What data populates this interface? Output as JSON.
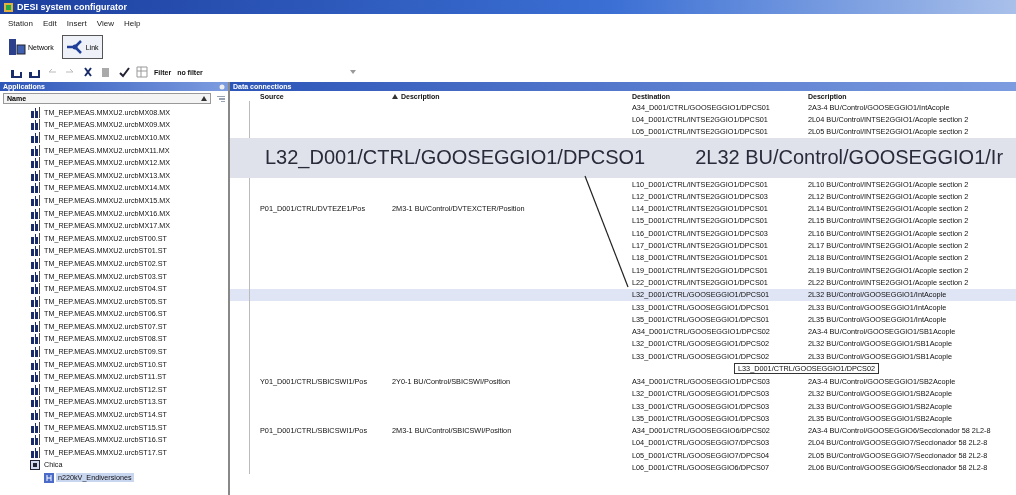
{
  "window": {
    "title": "DESI system configurator"
  },
  "menu": [
    "Station",
    "Edit",
    "Insert",
    "View",
    "Help"
  ],
  "modes": [
    {
      "label": "Network",
      "kind": "network",
      "selected": false
    },
    {
      "label": "Link",
      "kind": "link",
      "selected": true
    }
  ],
  "toolbar": {
    "filter_label": "Filter",
    "filter_value": "no filter"
  },
  "applications": {
    "title": "Applications",
    "column": "Name",
    "items": [
      {
        "label": "TM_REP.MEAS.MMXU2.urcbMX08.MX",
        "kind": "report"
      },
      {
        "label": "TM_REP.MEAS.MMXU2.urcbMX09.MX",
        "kind": "report"
      },
      {
        "label": "TM_REP.MEAS.MMXU2.urcbMX10.MX",
        "kind": "report"
      },
      {
        "label": "TM_REP.MEAS.MMXU2.urcbMX11.MX",
        "kind": "report"
      },
      {
        "label": "TM_REP.MEAS.MMXU2.urcbMX12.MX",
        "kind": "report"
      },
      {
        "label": "TM_REP.MEAS.MMXU2.urcbMX13.MX",
        "kind": "report"
      },
      {
        "label": "TM_REP.MEAS.MMXU2.urcbMX14.MX",
        "kind": "report"
      },
      {
        "label": "TM_REP.MEAS.MMXU2.urcbMX15.MX",
        "kind": "report"
      },
      {
        "label": "TM_REP.MEAS.MMXU2.urcbMX16.MX",
        "kind": "report"
      },
      {
        "label": "TM_REP.MEAS.MMXU2.urcbMX17.MX",
        "kind": "report"
      },
      {
        "label": "TM_REP.MEAS.MMXU2.urcbST00.ST",
        "kind": "report"
      },
      {
        "label": "TM_REP.MEAS.MMXU2.urcbST01.ST",
        "kind": "report"
      },
      {
        "label": "TM_REP.MEAS.MMXU2.urcbST02.ST",
        "kind": "report"
      },
      {
        "label": "TM_REP.MEAS.MMXU2.urcbST03.ST",
        "kind": "report"
      },
      {
        "label": "TM_REP.MEAS.MMXU2.urcbST04.ST",
        "kind": "report"
      },
      {
        "label": "TM_REP.MEAS.MMXU2.urcbST05.ST",
        "kind": "report"
      },
      {
        "label": "TM_REP.MEAS.MMXU2.urcbST06.ST",
        "kind": "report"
      },
      {
        "label": "TM_REP.MEAS.MMXU2.urcbST07.ST",
        "kind": "report"
      },
      {
        "label": "TM_REP.MEAS.MMXU2.urcbST08.ST",
        "kind": "report"
      },
      {
        "label": "TM_REP.MEAS.MMXU2.urcbST09.ST",
        "kind": "report"
      },
      {
        "label": "TM_REP.MEAS.MMXU2.urcbST10.ST",
        "kind": "report"
      },
      {
        "label": "TM_REP.MEAS.MMXU2.urcbST11.ST",
        "kind": "report"
      },
      {
        "label": "TM_REP.MEAS.MMXU2.urcbST12.ST",
        "kind": "report"
      },
      {
        "label": "TM_REP.MEAS.MMXU2.urcbST13.ST",
        "kind": "report"
      },
      {
        "label": "TM_REP.MEAS.MMXU2.urcbST14.ST",
        "kind": "report"
      },
      {
        "label": "TM_REP.MEAS.MMXU2.urcbST15.ST",
        "kind": "report"
      },
      {
        "label": "TM_REP.MEAS.MMXU2.urcbST16.ST",
        "kind": "report"
      },
      {
        "label": "TM_REP.MEAS.MMXU2.urcbST17.ST",
        "kind": "report"
      },
      {
        "label": "Chica",
        "kind": "station",
        "selected": false,
        "children": [
          {
            "label": "n220kV_Endiversiones",
            "kind": "voltage",
            "selected": true
          }
        ]
      }
    ]
  },
  "connections": {
    "title": "Data connections",
    "columns": [
      "Source",
      "Description",
      "Destination",
      "Description"
    ],
    "rows": [
      {
        "kind": "row",
        "selected": false,
        "destination": "A34_D001/CTRL/GOOSEGGIO1/DPCS01",
        "description": "2A3-4 BU/Control/GOOSEGGIO1/IntAcople"
      },
      {
        "kind": "row",
        "selected": false,
        "destination": "L04_D001/CTRL/INTSE2GGIO1/DPCS01",
        "description": "2L04 BU/Control/INTSE2GGIO1/Acople section 2"
      },
      {
        "kind": "row",
        "selected": false,
        "destination": "L05_D001/CTRL/INTSE2GGIO1/DPCS01",
        "description": "2L05 BU/Control/INTSE2GGIO1/Acople section 2"
      },
      {
        "kind": "magnifier",
        "destination": "L32_D001/CTRL/GOOSEGGIO1/DPCSO1",
        "description": "2L32 BU/Control/GOOSEGGIO1/Ir"
      },
      {
        "kind": "row",
        "selected": false,
        "destination": "L10_D001/CTRL/INTSE2GGIO1/DPCS01",
        "description": "2L10 BU/Control/INTSE2GGIO1/Acople section 2"
      },
      {
        "kind": "row",
        "selected": false,
        "destination": "L12_D001/CTRL/INTSE2GGIO1/DPCS03",
        "description": "2L12 BU/Control/INTSE2GGIO1/Acople section 2"
      },
      {
        "kind": "row",
        "selected": false,
        "source": "P01_D001/CTRL/DVTEZE1/Pos",
        "source_description": "2M3-1 BU/Control/DVTEXCTER/Position",
        "destination": "L14_D001/CTRL/INTSE2GGIO1/DPCS01",
        "description": "2L14 BU/Control/INTSE2GGIO1/Acople section 2"
      },
      {
        "kind": "row",
        "selected": false,
        "destination": "L15_D001/CTRL/INTSE2GGIO1/DPCS01",
        "description": "2L15 BU/Control/INTSE2GGIO1/Acople section 2"
      },
      {
        "kind": "row",
        "selected": false,
        "destination": "L16_D001/CTRL/INTSE2GGIO1/DPCS03",
        "description": "2L16 BU/Control/INTSE2GGIO1/Acople section 2"
      },
      {
        "kind": "row",
        "selected": false,
        "destination": "L17_D001/CTRL/INTSE2GGIO1/DPCS01",
        "description": "2L17 BU/Control/INTSE2GGIO1/Acople section 2"
      },
      {
        "kind": "row",
        "selected": false,
        "destination": "L18_D001/CTRL/INTSE2GGIO1/DPCS01",
        "description": "2L18 BU/Control/INTSE2GGIO1/Acople section 2"
      },
      {
        "kind": "row",
        "selected": false,
        "destination": "L19_D001/CTRL/INTSE2GGIO1/DPCS01",
        "description": "2L19 BU/Control/INTSE2GGIO1/Acople section 2"
      },
      {
        "kind": "row",
        "selected": false,
        "destination": "L22_D001/CTRL/INTSE2GGIO1/DPCS01",
        "description": "2L22 BU/Control/INTSE2GGIO1/Acople section 2"
      },
      {
        "kind": "row",
        "selected": true,
        "destination": "L32_D001/CTRL/GOOSEGGIO1/DPCS01",
        "description": "2L32 BU/Control/GOOSEGGIO1/IntAcople"
      },
      {
        "kind": "row",
        "selected": false,
        "destination": "L33_D001/CTRL/GOOSEGGIO1/DPCS01",
        "description": "2L33 BU/Control/GOOSEGGIO1/IntAcople"
      },
      {
        "kind": "row",
        "selected": false,
        "destination": "L35_D001/CTRL/GOOSEGGIO1/DPCS01",
        "description": "2L35 BU/Control/GOOSEGGIO1/IntAcople"
      },
      {
        "kind": "row",
        "selected": false,
        "destination": "A34_D001/CTRL/GOOSEGGIO1/DPCS02",
        "description": "2A3-4 BU/Control/GOOSEGGIO1/SB1Acople"
      },
      {
        "kind": "row",
        "selected": false,
        "destination": "L32_D001/CTRL/GOOSEGGIO1/DPCS02",
        "description": "2L32 BU/Control/GOOSEGGIO1/SB1Acople"
      },
      {
        "kind": "row",
        "selected": false,
        "destination": "L33_D001/CTRL/GOOSEGGIO1/DPCS02",
        "description": "2L33 BU/Control/GOOSEGGIO1/SB1Acople"
      },
      {
        "kind": "callout",
        "text": "L33_D001/CTRL/GOOSEGGIO1/DPCS02"
      },
      {
        "kind": "row",
        "selected": false,
        "source": "Y01_D001/CTRL/SBICSWI1/Pos",
        "source_description": "2Y0-1 BU/Control/SBICSWI/Position",
        "destination": "A34_D001/CTRL/GOOSEGGIO1/DPCS03",
        "description": "2A3-4 BU/Control/GOOSEGGIO1/SB2Acople"
      },
      {
        "kind": "row",
        "selected": false,
        "destination": "L32_D001/CTRL/GOOSEGGIO1/DPCS03",
        "description": "2L32 BU/Control/GOOSEGGIO1/SB2Acople"
      },
      {
        "kind": "row",
        "selected": false,
        "destination": "L33_D001/CTRL/GOOSEGGIO1/DPCS03",
        "description": "2L33 BU/Control/GOOSEGGIO1/SB2Acople"
      },
      {
        "kind": "row",
        "selected": false,
        "destination": "L35_D001/CTRL/GOOSEGGIO1/DPCS03",
        "description": "2L35 BU/Control/GOOSEGGIO1/SB2Acople"
      },
      {
        "kind": "row",
        "selected": false,
        "source": "P01_D001/CTRL/SBICSWI1/Pos",
        "source_description": "2M3-1 BU/Control/SBICSWI/Position",
        "destination": "A34_D001/CTRL/GOOSEGGIO6/DPCS02",
        "description": "2A3-4 BU/Control/GOOSEGGIO6/Seccionador 58 2L2-8"
      },
      {
        "kind": "row",
        "selected": false,
        "destination": "L04_D001/CTRL/GOOSEGGIO7/DPCS03",
        "description": "2L04 BU/Control/GOOSEGGIO7/Seccionador 58 2L2-8"
      },
      {
        "kind": "row",
        "selected": false,
        "destination": "L05_D001/CTRL/GOOSEGGIO7/DPCS04",
        "description": "2L05 BU/Control/GOOSEGGIO7/Seccionador 58 2L2-8"
      },
      {
        "kind": "row",
        "selected": false,
        "destination": "L06_D001/CTRL/GOOSEGGIO6/DPCS07",
        "description": "2L06 BU/Control/GOOSEGGIO6/Seccionador 58 2L2-8"
      }
    ]
  }
}
